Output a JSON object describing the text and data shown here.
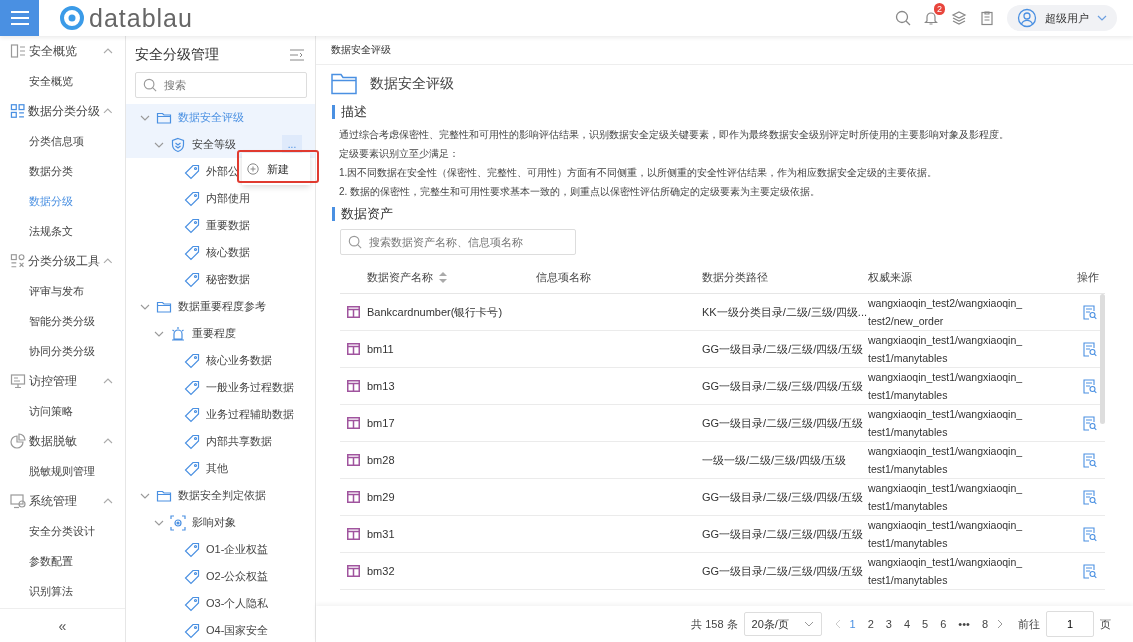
{
  "header": {
    "logo": "datablau",
    "notification_count": "2",
    "user": "超级用户"
  },
  "nav": [
    {
      "label": "安全概览",
      "kind": "overview",
      "expanded": true,
      "items": [
        {
          "label": "安全概览",
          "selected": false
        }
      ]
    },
    {
      "label": "数据分类分级",
      "kind": "grid",
      "expanded": true,
      "items": [
        {
          "label": "分类信息项",
          "selected": false
        },
        {
          "label": "数据分类",
          "selected": false
        },
        {
          "label": "数据分级",
          "selected": true
        },
        {
          "label": "法规条文",
          "selected": false
        }
      ]
    },
    {
      "label": "分类分级工具",
      "kind": "tools",
      "expanded": true,
      "items": [
        {
          "label": "评审与发布",
          "selected": false
        },
        {
          "label": "智能分类分级",
          "selected": false
        },
        {
          "label": "协同分类分级",
          "selected": false
        }
      ]
    },
    {
      "label": "访控管理",
      "kind": "monitor",
      "expanded": true,
      "items": [
        {
          "label": "访问策略",
          "selected": false
        }
      ]
    },
    {
      "label": "数据脱敏",
      "kind": "pie",
      "expanded": true,
      "items": [
        {
          "label": "脱敏规则管理",
          "selected": false
        }
      ]
    },
    {
      "label": "系统管理",
      "kind": "settings",
      "expanded": true,
      "items": [
        {
          "label": "安全分类设计",
          "selected": false
        },
        {
          "label": "参数配置",
          "selected": false
        },
        {
          "label": "识别算法",
          "selected": false
        }
      ]
    }
  ],
  "nav_collapse": "«",
  "tree_panel": {
    "title": "安全分级管理",
    "search_placeholder": "搜索",
    "nodes": [
      {
        "label": "数据安全评级",
        "kind": "folder",
        "expanded": true,
        "selected": true,
        "children": [
          {
            "label": "安全等级",
            "kind": "shield",
            "expanded": true,
            "selected": false,
            "hovered": true,
            "children": [
              {
                "label": "外部公",
                "kind": "tag",
                "selected": false
              },
              {
                "label": "内部使用",
                "kind": "tag",
                "selected": false
              },
              {
                "label": "重要数据",
                "kind": "tag",
                "selected": false
              },
              {
                "label": "核心数据",
                "kind": "tag",
                "selected": false
              },
              {
                "label": "秘密数据",
                "kind": "tag",
                "selected": false
              }
            ]
          }
        ]
      },
      {
        "label": "数据重要程度参考",
        "kind": "folder",
        "expanded": true,
        "selected": false,
        "children": [
          {
            "label": "重要程度",
            "kind": "alarm",
            "expanded": true,
            "selected": false,
            "children": [
              {
                "label": "核心业务数据",
                "kind": "tag",
                "selected": false
              },
              {
                "label": "一般业务过程数据",
                "kind": "tag",
                "selected": false
              },
              {
                "label": "业务过程辅助数据",
                "kind": "tag",
                "selected": false
              },
              {
                "label": "内部共享数据",
                "kind": "tag",
                "selected": false
              },
              {
                "label": "其他",
                "kind": "tag",
                "selected": false
              }
            ]
          }
        ]
      },
      {
        "label": "数据安全判定依据",
        "kind": "folder",
        "expanded": true,
        "selected": false,
        "children": [
          {
            "label": "影响对象",
            "kind": "target",
            "expanded": true,
            "selected": false,
            "children": [
              {
                "label": "O1-企业权益",
                "kind": "tag",
                "selected": false
              },
              {
                "label": "O2-公众权益",
                "kind": "tag",
                "selected": false
              },
              {
                "label": "O3-个人隐私",
                "kind": "tag",
                "selected": false
              },
              {
                "label": "O4-国家安全",
                "kind": "tag",
                "selected": false
              }
            ]
          }
        ]
      }
    ],
    "popup_menu": {
      "more": "...",
      "items": [
        "新建"
      ]
    }
  },
  "main": {
    "breadcrumb": "数据安全评级",
    "title": "数据安全评级",
    "description_heading": "描述",
    "description": [
      "通过综合考虑保密性、完整性和可用性的影响评估结果，识别数据安全定级关键要素，即作为最终数据安全级别评定时所使用的主要影响对象及影程度。",
      "定级要素识别立至少满足：",
      "1.因不同数据在安全性（保密性、完整性、可用性）方面有不同侧重，以所侧重的安全性评估结果，作为相应数据安全定级的主要依据。",
      "2. 数据的保密性，完整生和可用性要求基本一致的，则重点以保密性评估所确定的定级要素为主要定级依据。"
    ],
    "assets_heading": "数据资产",
    "search_placeholder": "搜索数据资产名称、信息项名称",
    "table": {
      "columns": [
        "数据资产名称",
        "信息项名称",
        "数据分类路径",
        "权威来源",
        "操作"
      ],
      "rows": [
        {
          "name": "Bankcardnumber(银行卡号)",
          "info": "",
          "path": "KK一级分类目录/二级/三级/四级...",
          "source": [
            "wangxiaoqin_test2/wangxiaoqin_",
            "test2/new_order"
          ]
        },
        {
          "name": "bm11",
          "info": "",
          "path": "GG一级目录/二级/三级/四级/五级",
          "source": [
            "wangxiaoqin_test1/wangxiaoqin_",
            "test1/manytables"
          ]
        },
        {
          "name": "bm13",
          "info": "",
          "path": "GG一级目录/二级/三级/四级/五级",
          "source": [
            "wangxiaoqin_test1/wangxiaoqin_",
            "test1/manytables"
          ]
        },
        {
          "name": "bm17",
          "info": "",
          "path": "GG一级目录/二级/三级/四级/五级",
          "source": [
            "wangxiaoqin_test1/wangxiaoqin_",
            "test1/manytables"
          ]
        },
        {
          "name": "bm28",
          "info": "",
          "path": "一级一级/二级/三级/四级/五级",
          "source": [
            "wangxiaoqin_test1/wangxiaoqin_",
            "test1/manytables"
          ]
        },
        {
          "name": "bm29",
          "info": "",
          "path": "GG一级目录/二级/三级/四级/五级",
          "source": [
            "wangxiaoqin_test1/wangxiaoqin_",
            "test1/manytables"
          ]
        },
        {
          "name": "bm31",
          "info": "",
          "path": "GG一级目录/二级/三级/四级/五级",
          "source": [
            "wangxiaoqin_test1/wangxiaoqin_",
            "test1/manytables"
          ]
        },
        {
          "name": "bm32",
          "info": "",
          "path": "GG一级目录/二级/三级/四级/五级",
          "source": [
            "wangxiaoqin_test1/wangxiaoqin_",
            "test1/manytables"
          ]
        }
      ]
    },
    "pagination": {
      "total": "共 158 条",
      "page_size": "20条/页",
      "pages": [
        {
          "label": "1",
          "selected": true
        },
        {
          "label": "2",
          "selected": false
        },
        {
          "label": "3",
          "selected": false
        },
        {
          "label": "4",
          "selected": false
        },
        {
          "label": "5",
          "selected": false
        },
        {
          "label": "6",
          "selected": false
        },
        {
          "label": "•••",
          "selected": false
        },
        {
          "label": "8",
          "selected": false
        }
      ],
      "goto_label": "前往",
      "goto_value": "1",
      "page_unit": "页"
    }
  }
}
